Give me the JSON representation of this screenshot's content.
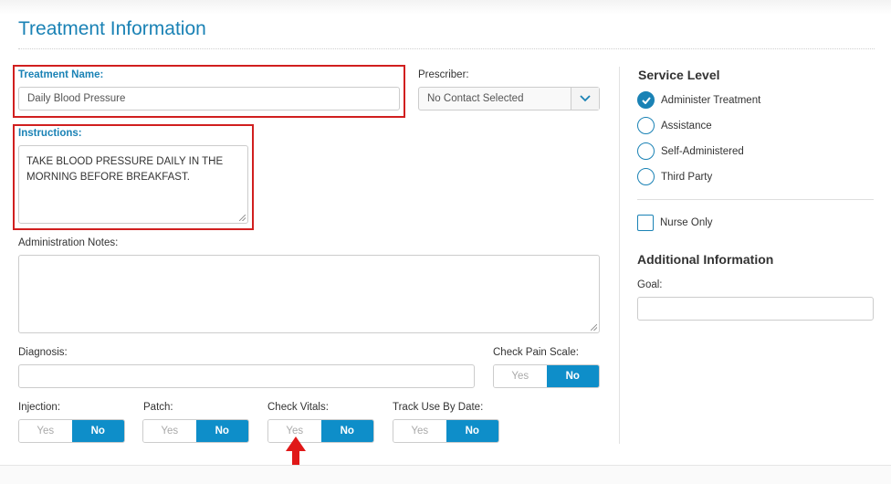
{
  "page": {
    "title": "Treatment Information"
  },
  "form": {
    "treatment_name": {
      "label": "Treatment Name:",
      "value": "Daily Blood Pressure"
    },
    "prescriber": {
      "label": "Prescriber:",
      "value": "No Contact Selected"
    },
    "instructions": {
      "label": "Instructions:",
      "value": "TAKE BLOOD PRESSURE DAILY IN THE MORNING BEFORE BREAKFAST."
    },
    "administration_notes": {
      "label": "Administration Notes:",
      "value": ""
    },
    "diagnosis": {
      "label": "Diagnosis:",
      "value": ""
    },
    "check_pain_scale": {
      "label": "Check Pain Scale:",
      "yes": "Yes",
      "no": "No",
      "selected": "No"
    },
    "injection": {
      "label": "Injection:",
      "yes": "Yes",
      "no": "No",
      "selected": "No"
    },
    "patch": {
      "label": "Patch:",
      "yes": "Yes",
      "no": "No",
      "selected": "No"
    },
    "check_vitals": {
      "label": "Check Vitals:",
      "yes": "Yes",
      "no": "No",
      "selected": "No"
    },
    "track_use_by_date": {
      "label": "Track Use By Date:",
      "yes": "Yes",
      "no": "No",
      "selected": "No"
    }
  },
  "service_level": {
    "heading": "Service Level",
    "options": [
      {
        "label": "Administer Treatment",
        "checked": true
      },
      {
        "label": "Assistance",
        "checked": false
      },
      {
        "label": "Self-Administered",
        "checked": false
      },
      {
        "label": "Third Party",
        "checked": false
      }
    ],
    "nurse_only": {
      "label": "Nurse Only",
      "checked": false
    }
  },
  "additional_information": {
    "heading": "Additional Information",
    "goal": {
      "label": "Goal:",
      "value": ""
    }
  },
  "colors": {
    "accent": "#1a82b5",
    "toggle_on": "#0e8ec9",
    "highlight": "#d11f1f"
  },
  "icons": [
    "chevron-down-icon",
    "checkmark-icon",
    "red-up-arrow-icon"
  ]
}
